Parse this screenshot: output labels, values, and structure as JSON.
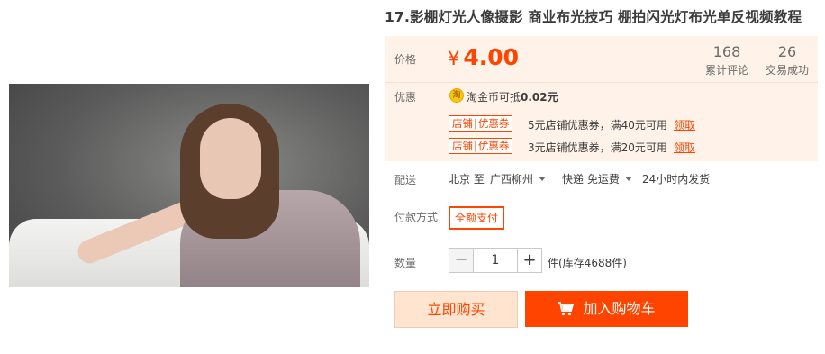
{
  "product": {
    "title": "17.影棚灯光人像摄影 商业布光技巧 棚拍闪光灯布光单反视频教程"
  },
  "price": {
    "label": "价格",
    "currency": "¥",
    "value": "4.00"
  },
  "stats": {
    "reviews_count": "168",
    "reviews_label": "累计评论",
    "sales_count": "26",
    "sales_label": "交易成功"
  },
  "promo": {
    "label": "优惠",
    "coin_icon_char": "淘",
    "coin_text": "淘金币可抵",
    "coin_amount": "0.02元",
    "coupons": [
      {
        "tag_left": "店铺",
        "tag_sep": "|",
        "tag_right": "优惠券",
        "text": "5元店铺优惠券，满40元可用",
        "link": "领取"
      },
      {
        "tag_left": "店铺",
        "tag_sep": "|",
        "tag_right": "优惠券",
        "text": "3元店铺优惠券，满20元可用",
        "link": "领取"
      }
    ]
  },
  "shipping": {
    "label": "配送",
    "origin": "北京 至",
    "destination": "广西柳州",
    "method": "快递 免运费",
    "dispatch": "24小时内发货"
  },
  "payment": {
    "label": "付款方式",
    "option": "全额支付"
  },
  "quantity": {
    "label": "数量",
    "minus": "−",
    "value": "1",
    "plus": "+",
    "stock": "件(库存4688件)"
  },
  "actions": {
    "buy_now": "立即购买",
    "add_to_cart": "加入购物车"
  },
  "colors": {
    "accent": "#ff4400",
    "panel_bg": "#fff2e8"
  }
}
